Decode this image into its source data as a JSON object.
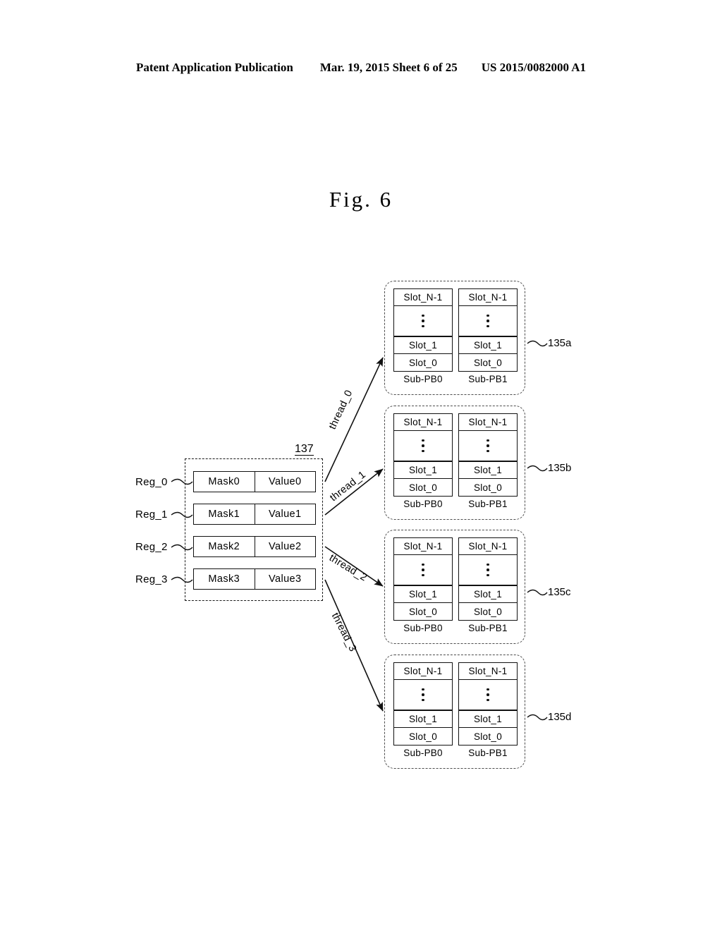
{
  "header": {
    "publication": "Patent Application Publication",
    "date_sheet": "Mar. 19, 2015  Sheet 6 of 25",
    "patent_number": "US 2015/0082000 A1"
  },
  "figure": {
    "title": "Fig.  6"
  },
  "register_group": {
    "ref": "137",
    "rows": [
      {
        "name": "Reg_0",
        "mask": "Mask0",
        "value": "Value0"
      },
      {
        "name": "Reg_1",
        "mask": "Mask1",
        "value": "Value1"
      },
      {
        "name": "Reg_2",
        "mask": "Mask2",
        "value": "Value2"
      },
      {
        "name": "Reg_3",
        "mask": "Mask3",
        "value": "Value3"
      }
    ]
  },
  "threads": [
    {
      "label": "thread_0"
    },
    {
      "label": "thread_1"
    },
    {
      "label": "thread_2"
    },
    {
      "label": "thread_3"
    }
  ],
  "slot_rows": {
    "top": "Slot_N-1",
    "dots": "vertical-ellipsis",
    "second": "Slot_1",
    "bottom": "Slot_0"
  },
  "page_buffers": [
    {
      "ref": "135a",
      "sub_pbs": [
        {
          "label": "Sub-PB0",
          "slots": [
            "Slot_N-1",
            "Slot_1",
            "Slot_0"
          ]
        },
        {
          "label": "Sub-PB1",
          "slots": [
            "Slot_N-1",
            "Slot_1",
            "Slot_0"
          ]
        }
      ]
    },
    {
      "ref": "135b",
      "sub_pbs": [
        {
          "label": "Sub-PB0",
          "slots": [
            "Slot_N-1",
            "Slot_1",
            "Slot_0"
          ]
        },
        {
          "label": "Sub-PB1",
          "slots": [
            "Slot_N-1",
            "Slot_1",
            "Slot_0"
          ]
        }
      ]
    },
    {
      "ref": "135c",
      "sub_pbs": [
        {
          "label": "Sub-PB0",
          "slots": [
            "Slot_N-1",
            "Slot_1",
            "Slot_0"
          ]
        },
        {
          "label": "Sub-PB1",
          "slots": [
            "Slot_N-1",
            "Slot_1",
            "Slot_0"
          ]
        }
      ]
    },
    {
      "ref": "135d",
      "sub_pbs": [
        {
          "label": "Sub-PB0",
          "slots": [
            "Slot_N-1",
            "Slot_1",
            "Slot_0"
          ]
        },
        {
          "label": "Sub-PB1",
          "slots": [
            "Slot_N-1",
            "Slot_1",
            "Slot_0"
          ]
        }
      ]
    }
  ],
  "colors": {
    "ink": "#000000",
    "dashed_border": "#4d4d4d",
    "page_background": "#ffffff"
  }
}
